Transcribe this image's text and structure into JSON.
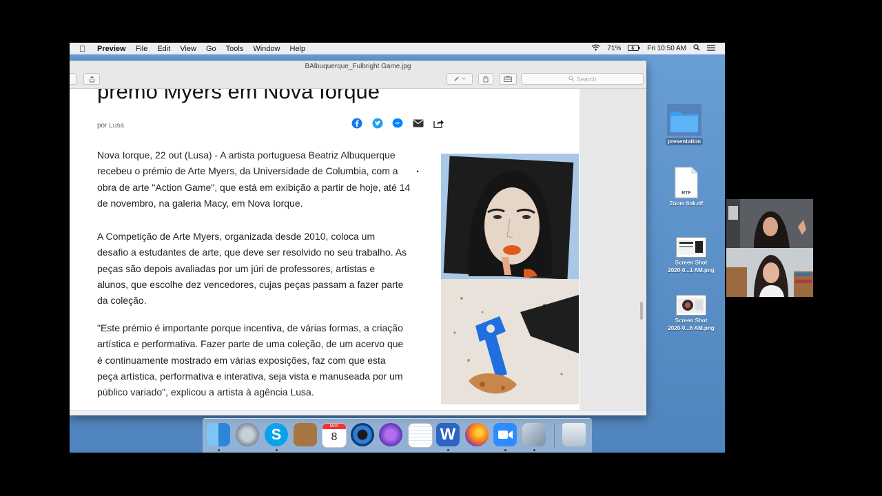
{
  "menubar": {
    "app": "Preview",
    "items": [
      "File",
      "Edit",
      "View",
      "Go",
      "Tools",
      "Window",
      "Help"
    ],
    "battery": "71%",
    "clock": "Fri 10:50 AM"
  },
  "window": {
    "title": "BAlbuquerque_Fulbright Game.jpg",
    "search_placeholder": "Search"
  },
  "article": {
    "headline": "premo Myers em Nova Iorque",
    "byline": "por Lusa",
    "paragraphs": [
      [
        "Nova Iorque, 22 out (Lusa) - A artista portuguesa Beatriz Albuquerque",
        "recebeu o prémio de Arte Myers, da Universidade de Columbia, com a",
        "obra de arte \"Action Game\", que está em exibição a partir de hoje, até 14",
        "de novembro, na galeria Macy, em Nova Iorque."
      ],
      [
        "A Competição de Arte Myers, organizada desde 2010, coloca um",
        "desafio a estudantes de arte, que deve ser resolvido no seu trabalho. As",
        "peças são depois avaliadas por um júri de professores, artistas e",
        "alunos, que escolhe dez vencedores, cujas peças passam a fazer parte",
        "da coleção."
      ],
      [
        "\"Este prémio é importante porque incentiva, de várias formas, a criação",
        "artística e performativa. Fazer parte de uma coleção, de um acervo que",
        "é continuamente mostrado em várias exposições, faz com que esta",
        "peça artística, performativa e interativa, seja vista e manuseada por um",
        "público variado\", explicou a artista à agência Lusa."
      ]
    ]
  },
  "desktop": {
    "folder_label": "presentation",
    "rtf_label": "Zoom link.rtf",
    "rtf_badge": "RTF",
    "shot1_label": [
      "Screen Shot",
      "2020-0...1 AM.png"
    ],
    "shot2_label": [
      "Screen Shot",
      "2020-0...6 AM.png"
    ]
  },
  "dock": {
    "calendar_month": "MAY",
    "calendar_day": "8",
    "items": [
      "finder",
      "launchpad",
      "skype",
      "notefile",
      "calendar",
      "quicktime",
      "imovie",
      "textedit",
      "word",
      "firefox",
      "zoom",
      "preview",
      "trash"
    ]
  },
  "colors": {
    "facebook": "#1877f2",
    "twitter": "#1da1f2",
    "messenger": "#0084ff",
    "desktop": "#5b8fc7"
  }
}
